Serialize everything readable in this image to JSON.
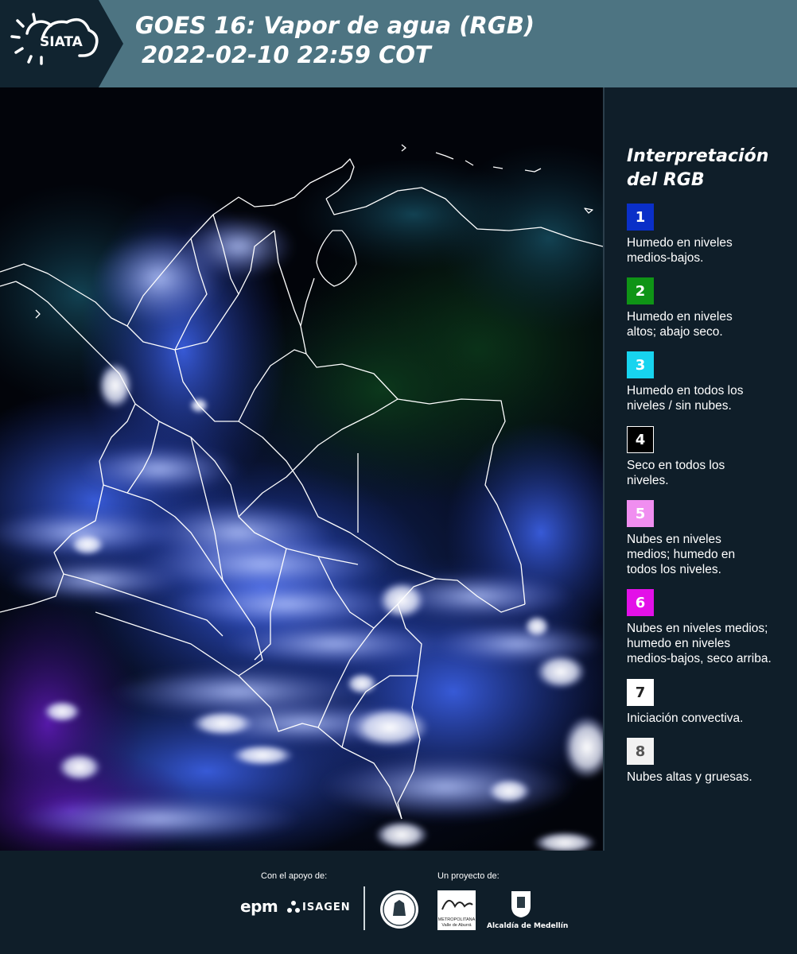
{
  "header": {
    "logo_text": "SIATA",
    "title_line1": "GOES 16: Vapor de agua (RGB)",
    "title_line2": "2022-02-10 22:59 COT"
  },
  "legend": {
    "title_line1": "Interpretación",
    "title_line2": "del RGB",
    "items": [
      {
        "number": "1",
        "label_line1": "Humedo en niveles",
        "label_line2": "medios-bajos.",
        "label_line3": "",
        "color": "#0a2fc8",
        "text_color": "#ffffff"
      },
      {
        "number": "2",
        "label_line1": "Humedo en niveles",
        "label_line2": "altos; abajo seco.",
        "label_line3": "",
        "color": "#0f9416",
        "text_color": "#ffffff"
      },
      {
        "number": "3",
        "label_line1": "Humedo en todos los",
        "label_line2": "niveles / sin nubes.",
        "label_line3": "",
        "color": "#17d4ef",
        "text_color": "#ffffff"
      },
      {
        "number": "4",
        "label_line1": "Seco en todos los",
        "label_line2": "niveles.",
        "label_line3": "",
        "color": "#000000",
        "text_color": "#ffffff"
      },
      {
        "number": "5",
        "label_line1": "Nubes en niveles",
        "label_line2": "medios; humedo en",
        "label_line3": "todos los niveles.",
        "color": "#f08ef0",
        "text_color": "#ffffff"
      },
      {
        "number": "6",
        "label_line1": "Nubes en niveles medios;",
        "label_line2": "humedo en niveles",
        "label_line3": "medios-bajos, seco arriba.",
        "color": "#e310e8",
        "text_color": "#ffffff"
      },
      {
        "number": "7",
        "label_line1": "Iniciación convectiva.",
        "label_line2": "",
        "label_line3": "",
        "color": "#ffffff",
        "text_color": "#222222"
      },
      {
        "number": "8",
        "label_line1": "Nubes altas y gruesas.",
        "label_line2": "",
        "label_line3": "",
        "color": "#f2f2f2",
        "text_color": "#555555"
      }
    ]
  },
  "footer": {
    "support_caption": "Con el apoyo de:",
    "project_caption": "Un proyecto de:",
    "sponsor_epm": "epm",
    "sponsor_isagen": "ISAGEN",
    "metropolitana_line1": "METROPOLITANA",
    "metropolitana_line2": "Valle de Aburrá",
    "alcaldia": "Alcaldía de Medellín"
  },
  "colors": {
    "header_bg": "#4d7482",
    "panel_bg": "#0f1e29"
  }
}
